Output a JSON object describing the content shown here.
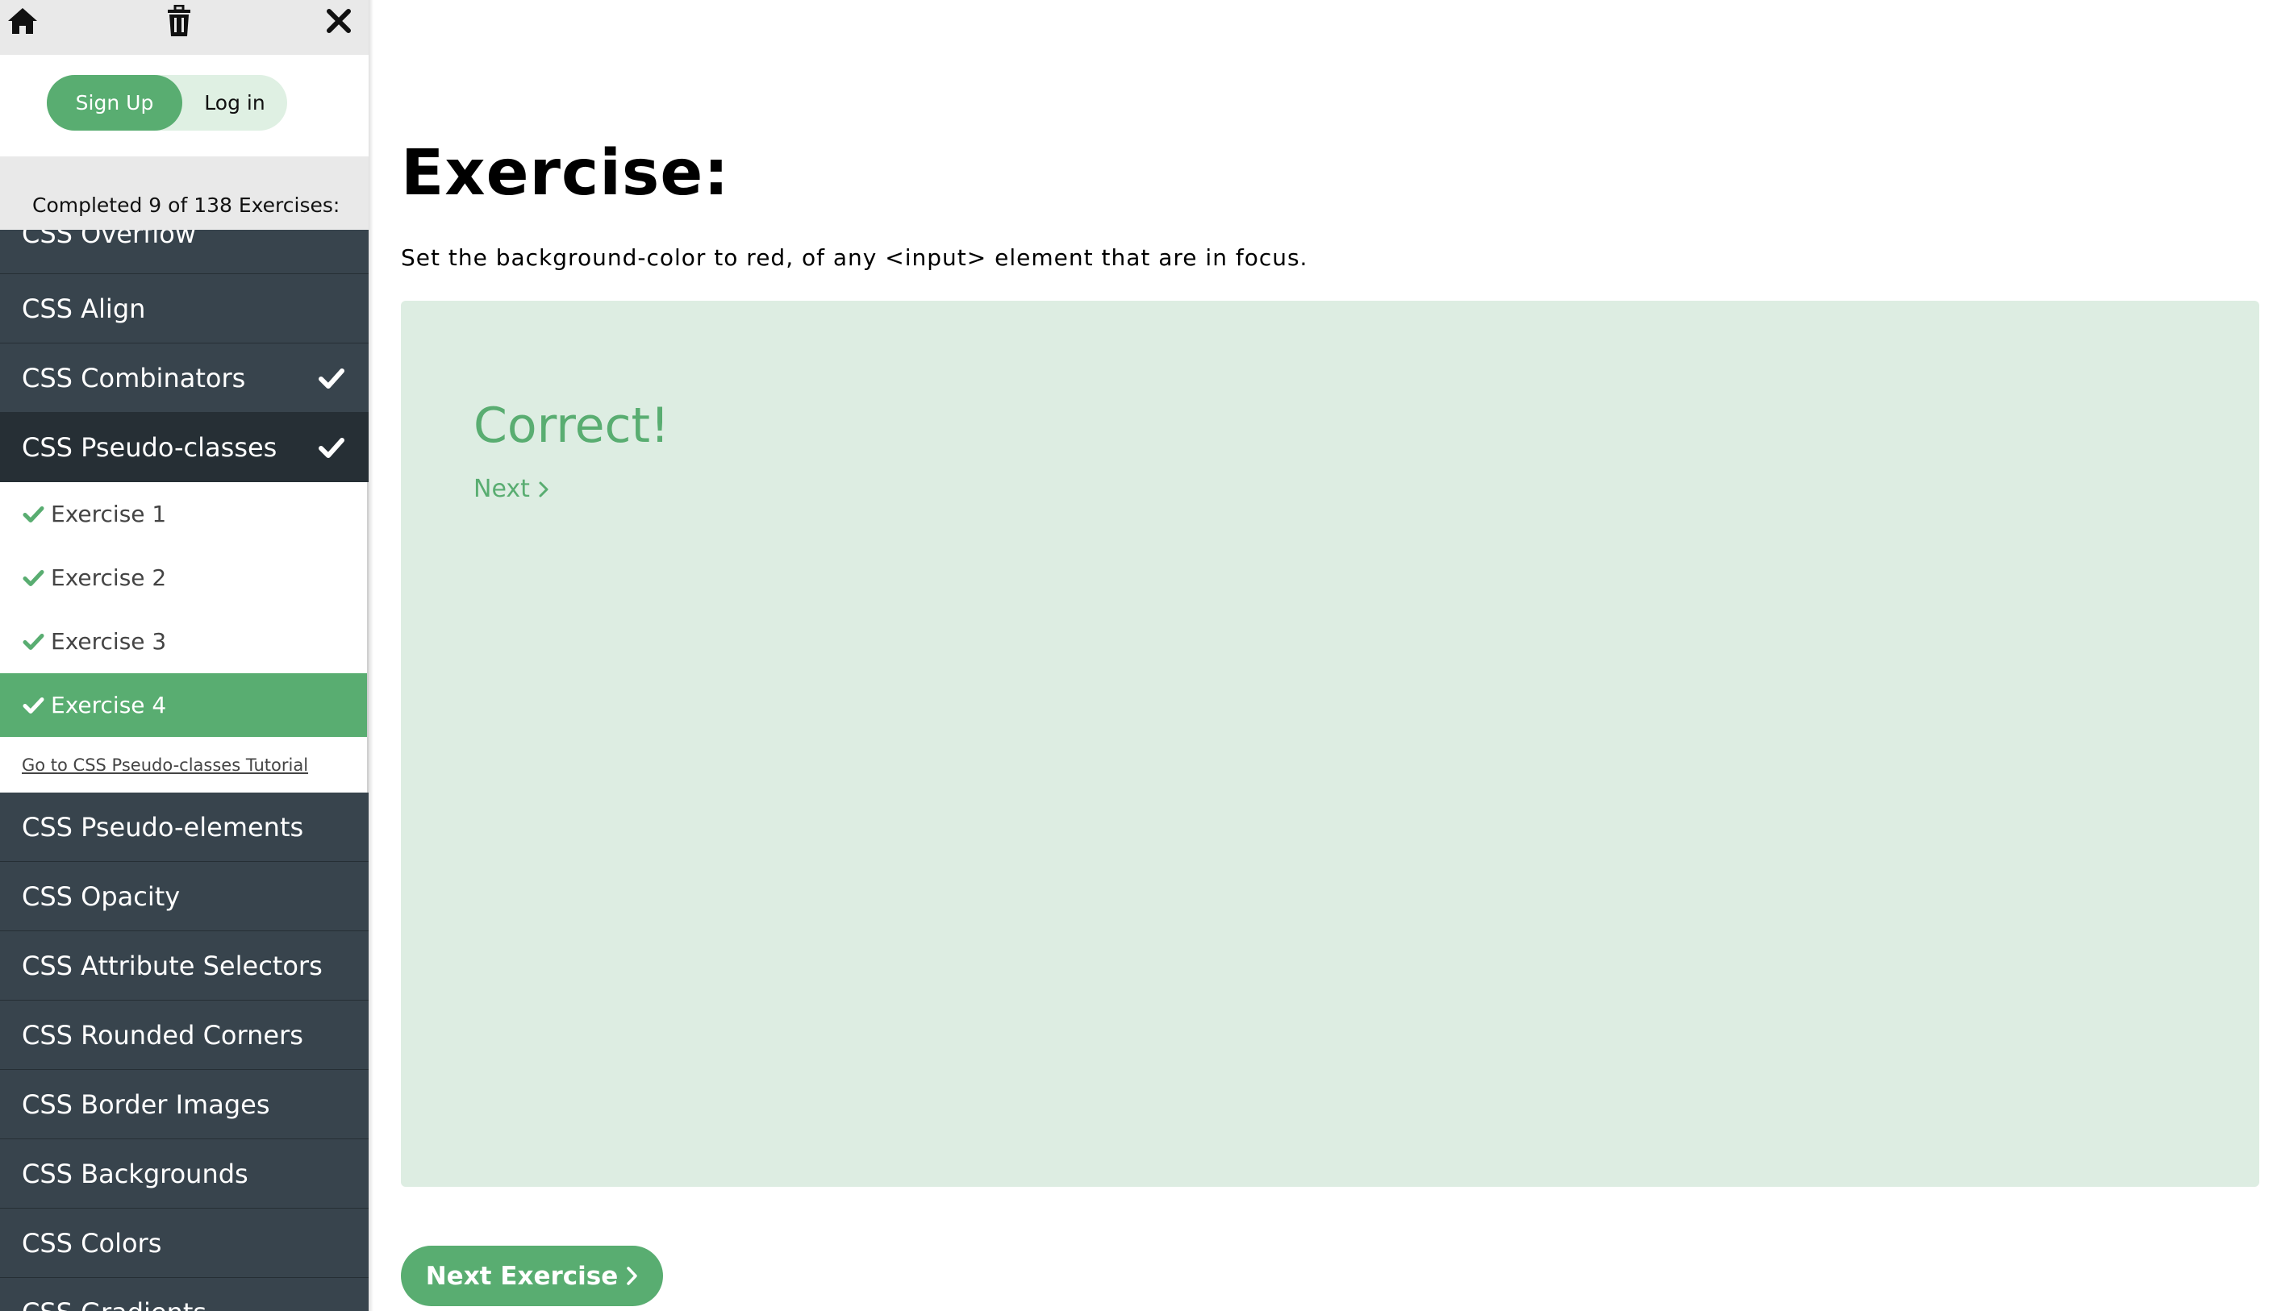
{
  "colors": {
    "accent": "#59ad71",
    "sidebar_bg": "#38444d",
    "sidebar_active": "#262f35",
    "result_bg": "#ddede2"
  },
  "toolbar": {
    "icons": [
      "home-icon",
      "trash-icon",
      "close-icon"
    ]
  },
  "auth": {
    "signup_label": "Sign Up",
    "login_label": "Log in"
  },
  "progress": {
    "text": "Completed 9 of 138 Exercises:"
  },
  "sidebar": {
    "topics_before": [
      {
        "label": "CSS Overflow",
        "completed": false
      },
      {
        "label": "CSS Align",
        "completed": false
      },
      {
        "label": "CSS Combinators",
        "completed": true
      }
    ],
    "active_topic": {
      "label": "CSS Pseudo-classes",
      "completed": true
    },
    "exercises": [
      {
        "label": "Exercise 1",
        "completed": true
      },
      {
        "label": "Exercise 2",
        "completed": true
      },
      {
        "label": "Exercise 3",
        "completed": true
      },
      {
        "label": "Exercise 4",
        "completed": true,
        "current": true
      }
    ],
    "tutorial_link": "Go to CSS Pseudo-classes Tutorial",
    "topics_after": [
      {
        "label": "CSS Pseudo-elements"
      },
      {
        "label": "CSS Opacity"
      },
      {
        "label": "CSS Attribute Selectors"
      },
      {
        "label": "CSS Rounded Corners"
      },
      {
        "label": "CSS Border Images"
      },
      {
        "label": "CSS Backgrounds"
      },
      {
        "label": "CSS Colors"
      },
      {
        "label": "CSS Gradients"
      }
    ]
  },
  "main": {
    "title": "Exercise:",
    "description": "Set the background-color to red, of any <input> element that are in focus.",
    "result_text": "Correct!",
    "next_link": "Next",
    "next_exercise_button": "Next Exercise"
  }
}
